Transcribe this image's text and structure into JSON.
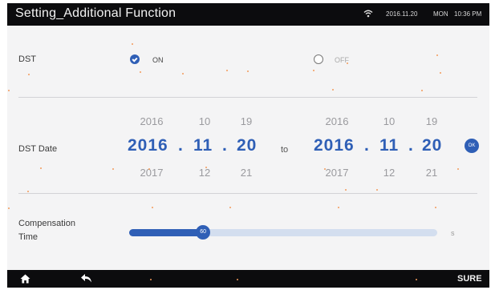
{
  "header": {
    "title": "Setting_Additional Function",
    "date": "2016.11.20",
    "weekday": "MON",
    "time": "10:36 PM"
  },
  "dst": {
    "label": "DST",
    "on_label": "ON",
    "off_label": "OFF",
    "selected": "ON"
  },
  "dst_date": {
    "label": "DST Date",
    "to_label": "to",
    "start": {
      "prev": [
        "2016",
        "10",
        "19"
      ],
      "selected": [
        "2016",
        "11",
        "20"
      ],
      "next": [
        "2017",
        "12",
        "21"
      ]
    },
    "end": {
      "prev": [
        "2016",
        "10",
        "19"
      ],
      "selected": [
        "2016",
        "11",
        "20"
      ],
      "next": [
        "2017",
        "12",
        "21"
      ]
    },
    "separator": ".",
    "confirm_label": "OK"
  },
  "compensation": {
    "label_line1": "Compensation",
    "label_line2": "Time",
    "value": "60",
    "value_fraction": 0.24,
    "unit": "s"
  },
  "footer": {
    "sure_label": "SURE"
  },
  "colors": {
    "accent": "#2f5fb6",
    "bar": "#0c0c0e",
    "track": "#d3deef",
    "background": "#f4f4f5"
  }
}
